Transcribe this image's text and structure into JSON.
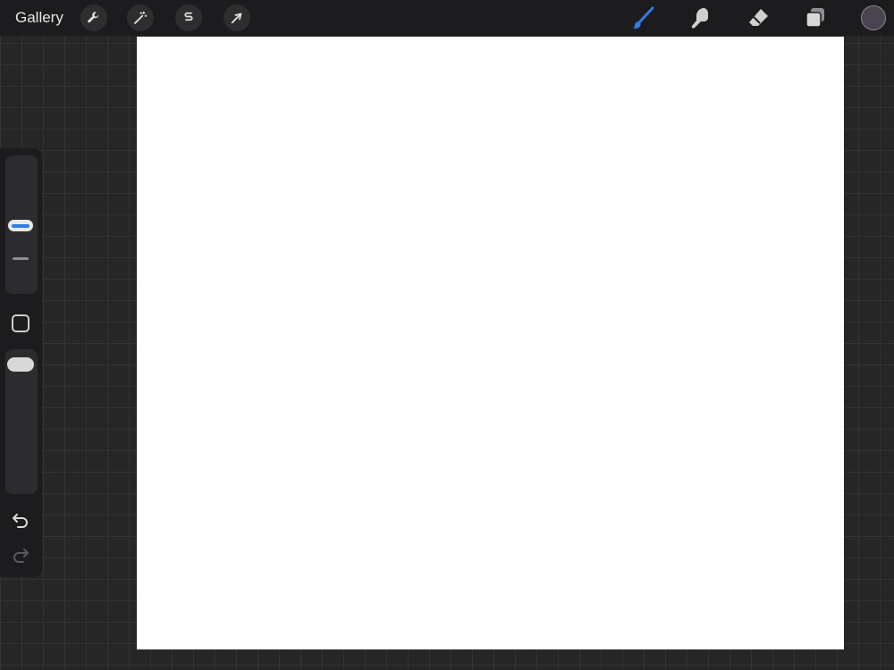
{
  "topbar": {
    "gallery_label": "Gallery",
    "left_tools": [
      {
        "name": "actions",
        "icon": "wrench-icon"
      },
      {
        "name": "adjustments",
        "icon": "magic-wand-icon"
      },
      {
        "name": "selection",
        "icon": "selection-s-icon"
      },
      {
        "name": "transform",
        "icon": "arrow-cursor-icon"
      }
    ],
    "right_tools": [
      {
        "name": "brush",
        "icon": "brush-icon",
        "active": true
      },
      {
        "name": "smudge",
        "icon": "smudge-finger-icon",
        "active": false
      },
      {
        "name": "eraser",
        "icon": "eraser-icon",
        "active": false
      },
      {
        "name": "layers",
        "icon": "layers-icon",
        "active": false
      }
    ],
    "current_color": "#4a4450"
  },
  "colors": {
    "accent": "#2f7de1",
    "toolbar_bg": "#1c1c1e",
    "canvas": "#ffffff"
  },
  "sidebar": {
    "brush_size_handle_color": "#2f7de1",
    "modify_button_icon": "square-icon",
    "undo_icon": "undo-icon",
    "redo_icon": "redo-icon"
  }
}
